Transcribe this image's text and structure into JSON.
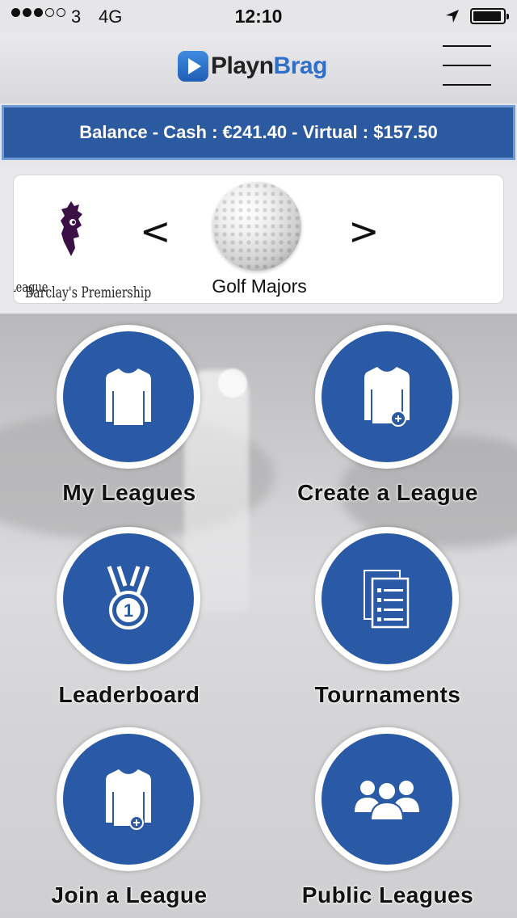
{
  "status_bar": {
    "carrier": "3",
    "network": "4G",
    "time": "12:10"
  },
  "header": {
    "logo_part1": "Playn",
    "logo_part2": "Brag"
  },
  "balance": {
    "text": "Balance - Cash :  €241.40 - Virtual : $157.50"
  },
  "sport_selector": {
    "prev_label": "League",
    "prev_label2": "Barclay's Premiership",
    "left_arrow": "<",
    "right_arrow": ">",
    "current": "Golf Majors"
  },
  "tiles": [
    {
      "label": "My Leagues",
      "icon": "shirt-icon"
    },
    {
      "label": "Create a League",
      "icon": "shirt-add-icon"
    },
    {
      "label": "Leaderboard",
      "icon": "medal-icon"
    },
    {
      "label": "Tournaments",
      "icon": "document-list-icon"
    },
    {
      "label": "Join a League",
      "icon": "shirt-join-icon"
    },
    {
      "label": "Public Leagues",
      "icon": "group-icon"
    }
  ],
  "colors": {
    "accent": "#2a5aa6",
    "balance_bg": "#2c5aa0",
    "brand_blue": "#2e6fc9"
  }
}
